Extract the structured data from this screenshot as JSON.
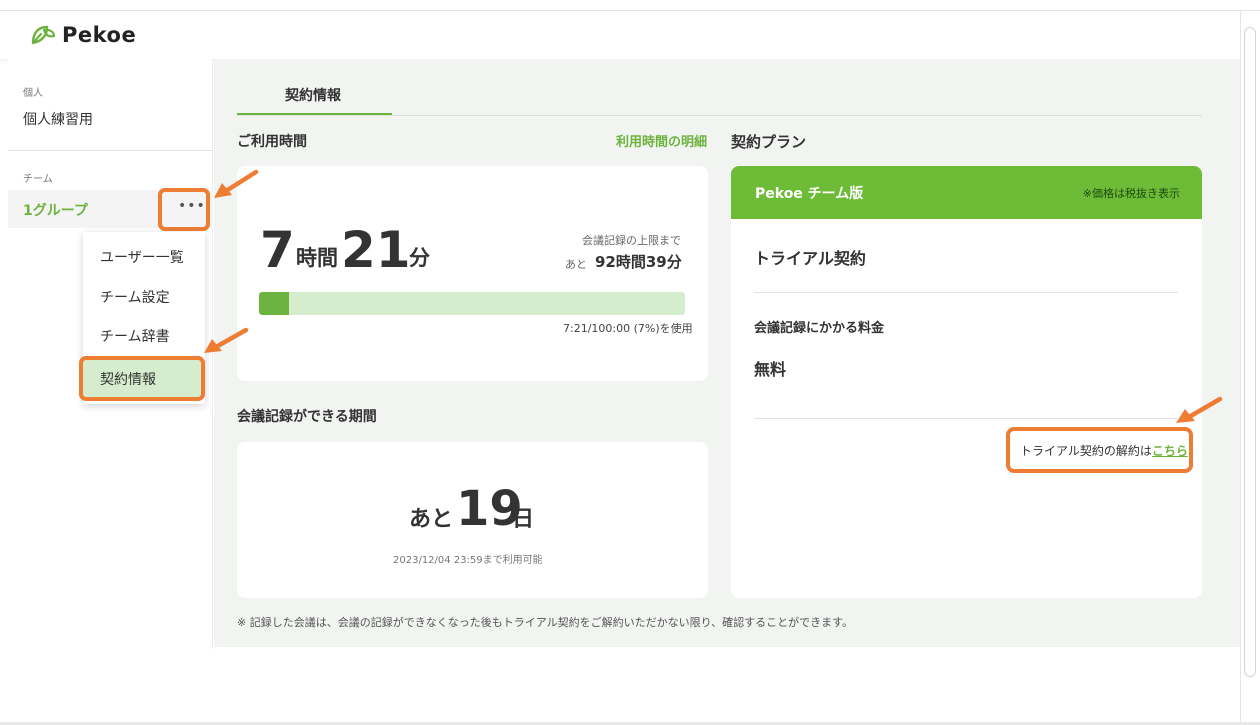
{
  "app": {
    "name": "Pekoe"
  },
  "sidebar": {
    "personal_section": "個人",
    "personal_item": "個人練習用",
    "team_section": "チーム",
    "group_item": "1グループ",
    "more_label": "•••"
  },
  "dropdown": {
    "items": [
      "ユーザー一覧",
      "チーム設定",
      "チーム辞書",
      "契約情報"
    ]
  },
  "tab": {
    "label": "契約情報"
  },
  "usage": {
    "title": "ご利用時間",
    "detail_link": "利用時間の明細",
    "hours": "7",
    "hours_unit": "時間",
    "minutes": "21",
    "minutes_unit": "分",
    "limit_label": "会議記録の上限まで",
    "remaining_prefix": "あと",
    "remaining_value": "92時間39分",
    "progress_fraction": 0.07,
    "progress_caption": "7:21/100:00 (7%)を使用"
  },
  "period": {
    "title": "会議記録ができる期間",
    "prefix": "あと",
    "days": "19",
    "unit": "日",
    "until": "2023/12/04 23:59まで利用可能"
  },
  "plan": {
    "title": "契約プラン",
    "name": "Pekoe チーム版",
    "tax_note": "※価格は税抜き表示",
    "contract_type": "トライアル契約",
    "fee_label": "会議記録にかかる料金",
    "fee_value": "無料",
    "cancel_text": "トライアル契約の解約は",
    "cancel_link": "こちら"
  },
  "footnote": "※ 記録した会議は、会議の記録ができなくなった後もトライアル契約をご解約いただかない限り、確認することができます。",
  "colors": {
    "brand_green": "#6db33f",
    "highlight_orange": "#ee7d33",
    "progress_bg": "#d5eccd"
  }
}
